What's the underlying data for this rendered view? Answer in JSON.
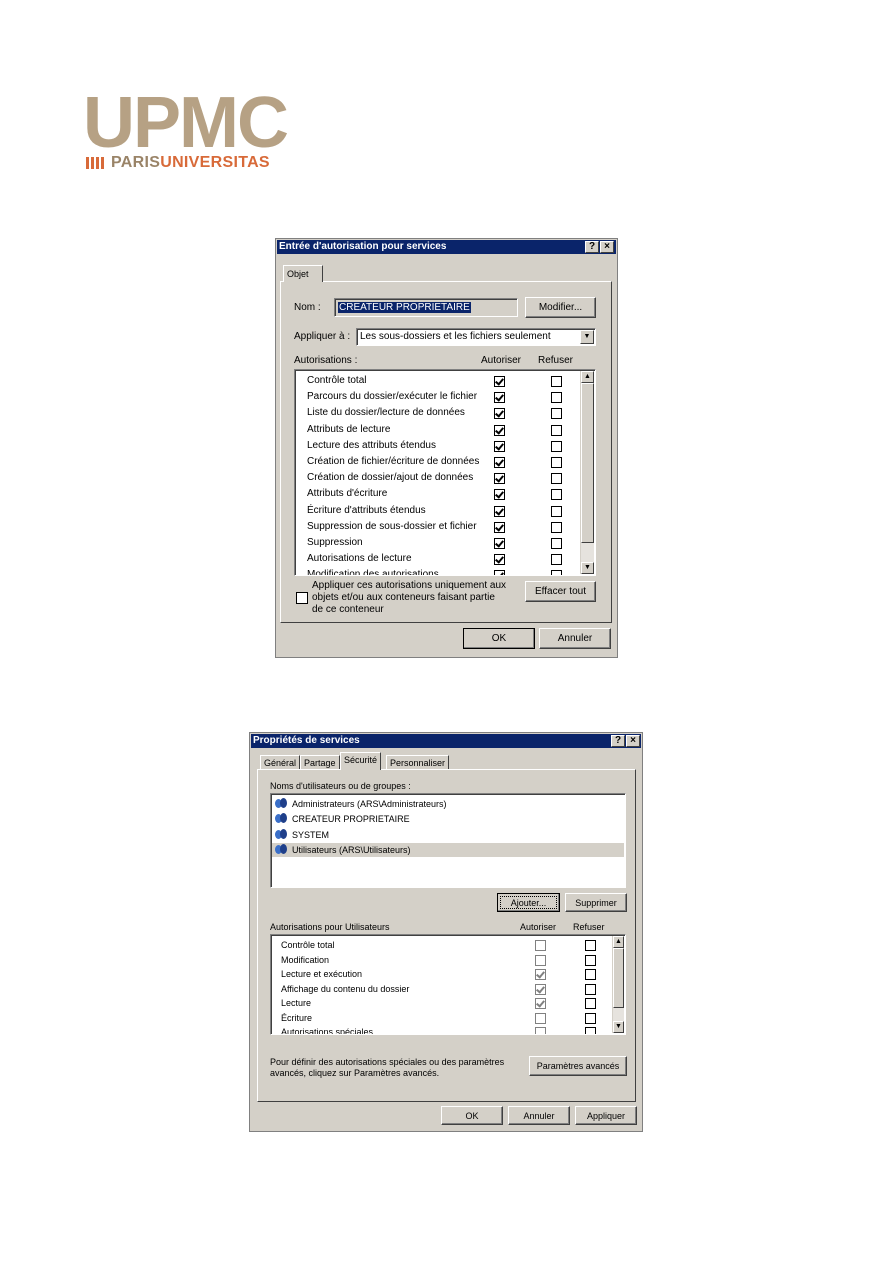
{
  "logo": {
    "word": "UPMC",
    "paris": "PARIS",
    "universitas": "UNIVERSITAS"
  },
  "dialog1": {
    "title": "Entrée d'autorisation pour services",
    "help_btn": "?",
    "close_btn": "×",
    "tab": "Objet",
    "name_label": "Nom :",
    "name_value": "CREATEUR PROPRIETAIRE",
    "modify_btn": "Modifier...",
    "apply_label": "Appliquer à :",
    "apply_value": "Les sous-dossiers et les fichiers seulement",
    "permissions_label": "Autorisations :",
    "allow_header": "Autoriser",
    "deny_header": "Refuser",
    "permissions": [
      {
        "label": "Contrôle total",
        "allow": true,
        "deny": false
      },
      {
        "label": "Parcours du dossier/exécuter le fichier",
        "allow": true,
        "deny": false
      },
      {
        "label": "Liste du dossier/lecture de données",
        "allow": true,
        "deny": false
      },
      {
        "label": "Attributs de lecture",
        "allow": true,
        "deny": false
      },
      {
        "label": "Lecture des attributs étendus",
        "allow": true,
        "deny": false
      },
      {
        "label": "Création de fichier/écriture de données",
        "allow": true,
        "deny": false
      },
      {
        "label": "Création de dossier/ajout de données",
        "allow": true,
        "deny": false
      },
      {
        "label": "Attributs d'écriture",
        "allow": true,
        "deny": false
      },
      {
        "label": "Écriture d'attributs étendus",
        "allow": true,
        "deny": false
      },
      {
        "label": "Suppression de sous-dossier et fichier",
        "allow": true,
        "deny": false
      },
      {
        "label": "Suppression",
        "allow": true,
        "deny": false
      },
      {
        "label": "Autorisations de lecture",
        "allow": true,
        "deny": false
      },
      {
        "label": "Modification des autorisations",
        "allow": true,
        "deny": false
      }
    ],
    "apply_only_line1": "Appliquer ces autorisations uniquement aux",
    "apply_only_line2": "objets et/ou aux conteneurs faisant partie",
    "apply_only_line3": "de ce conteneur",
    "clear_all_btn": "Effacer tout",
    "ok_btn": "OK",
    "cancel_btn": "Annuler"
  },
  "dialog2": {
    "title": "Propriétés de services",
    "help_btn": "?",
    "close_btn": "×",
    "tabs": [
      "Général",
      "Partage",
      "Sécurité",
      "Personnaliser"
    ],
    "groups_label": "Noms d'utilisateurs ou de groupes :",
    "users": [
      "Administrateurs (ARS\\Administrateurs)",
      "CREATEUR PROPRIETAIRE",
      "SYSTEM",
      "Utilisateurs (ARS\\Utilisateurs)"
    ],
    "add_btn": "Ajouter...",
    "remove_btn": "Supprimer",
    "perms_for_label": "Autorisations pour Utilisateurs",
    "allow_header": "Autoriser",
    "deny_header": "Refuser",
    "permissions": [
      {
        "label": "Contrôle total",
        "allow": false,
        "deny": false
      },
      {
        "label": "Modification",
        "allow": false,
        "deny": false
      },
      {
        "label": "Lecture et exécution",
        "allow": true,
        "deny": false
      },
      {
        "label": "Affichage du contenu du dossier",
        "allow": true,
        "deny": false
      },
      {
        "label": "Lecture",
        "allow": true,
        "deny": false
      },
      {
        "label": "Écriture",
        "allow": false,
        "deny": false
      },
      {
        "label": "Autorisations spéciales",
        "allow": false,
        "deny": false
      }
    ],
    "advanced_text_line1": "Pour définir des autorisations spéciales ou des paramètres",
    "advanced_text_line2": "avancés, cliquez sur Paramètres avancés.",
    "advanced_btn": "Paramètres avancés",
    "ok_btn": "OK",
    "cancel_btn": "Annuler",
    "apply_btn": "Appliquer"
  }
}
